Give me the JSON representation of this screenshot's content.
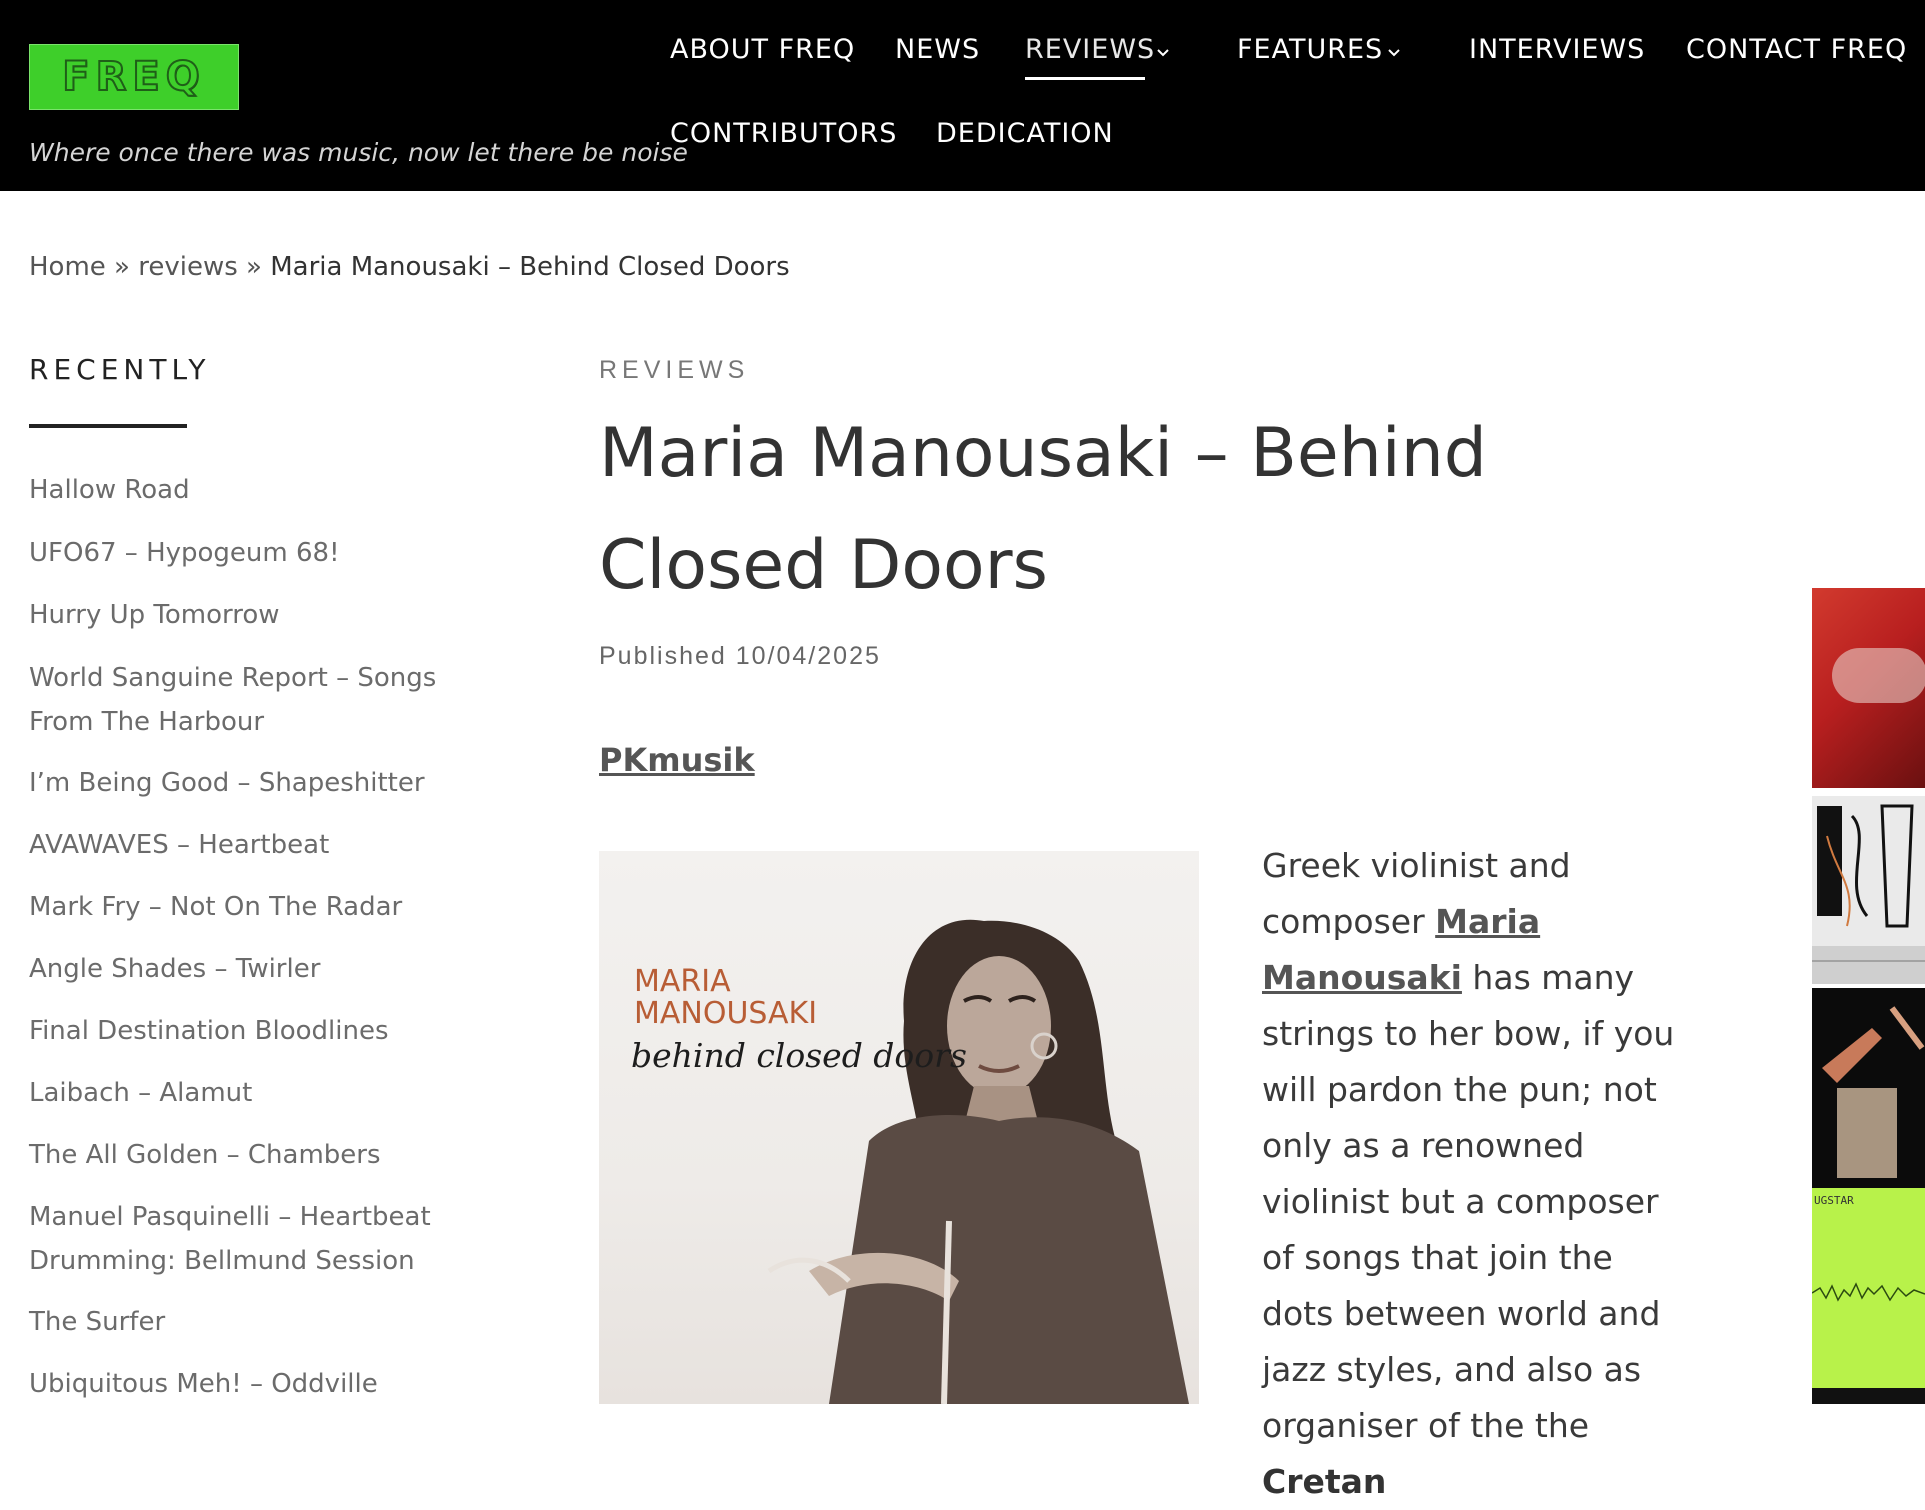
{
  "site": {
    "logo_text": "FREQ",
    "tagline": "Where once there was music, now let there be noise"
  },
  "nav": {
    "items": [
      {
        "label": "ABOUT FREQ"
      },
      {
        "label": "NEWS"
      },
      {
        "label": "REVIEWS",
        "active": true,
        "has_dropdown": true
      },
      {
        "label": "FEATURES",
        "has_dropdown": true
      },
      {
        "label": "INTERVIEWS"
      },
      {
        "label": "CONTACT FREQ"
      },
      {
        "label": "CONTRIBUTORS"
      },
      {
        "label": "DEDICATION"
      }
    ]
  },
  "breadcrumb": {
    "home": "Home",
    "sep": "»",
    "section": "reviews",
    "current": "Maria Manousaki – Behind Closed Doors"
  },
  "sidebar": {
    "heading": "RECENTLY",
    "items": [
      "Hallow Road",
      "UFO67 – Hypogeum 68!",
      "Hurry Up Tomorrow",
      "World Sanguine Report – Songs From The Harbour",
      "I’m Being Good – Shapeshitter",
      "AVAWAVES – Heartbeat",
      "Mark Fry – Not On The Radar",
      "Angle Shades – Twirler",
      "Final Destination Bloodlines",
      "Laibach – Alamut",
      "The All Golden – Chambers",
      "Manuel Pasquinelli – Heartbeat Drumming: Bellmund Session",
      "The Surfer",
      "Ubiquitous Meh! – Oddville"
    ]
  },
  "article": {
    "category": "REVIEWS",
    "title": "Maria Manousaki – Behind Closed Doors",
    "published": "Published 10/04/2025",
    "label_link": "PKmusik",
    "cover": {
      "artist": "MARIA\nMANOUSAKI",
      "album": "behind closed doors"
    },
    "body": {
      "before_link": "Greek violinist and composer ",
      "link": "Maria Manousaki",
      "after_link": " has many strings to her bow, if you will pardon the pun; not only as a renowned violinist but a composer of songs that join the dots between world and jazz styles, and also as organiser of the the ",
      "strong": "Cretan"
    }
  },
  "thumbnails": {
    "thumb3_label": "UGSTAR"
  },
  "colors": {
    "header_bg": "#000000",
    "logo_green": "#3ecf2a",
    "thumb_lime": "#b8f24a"
  }
}
